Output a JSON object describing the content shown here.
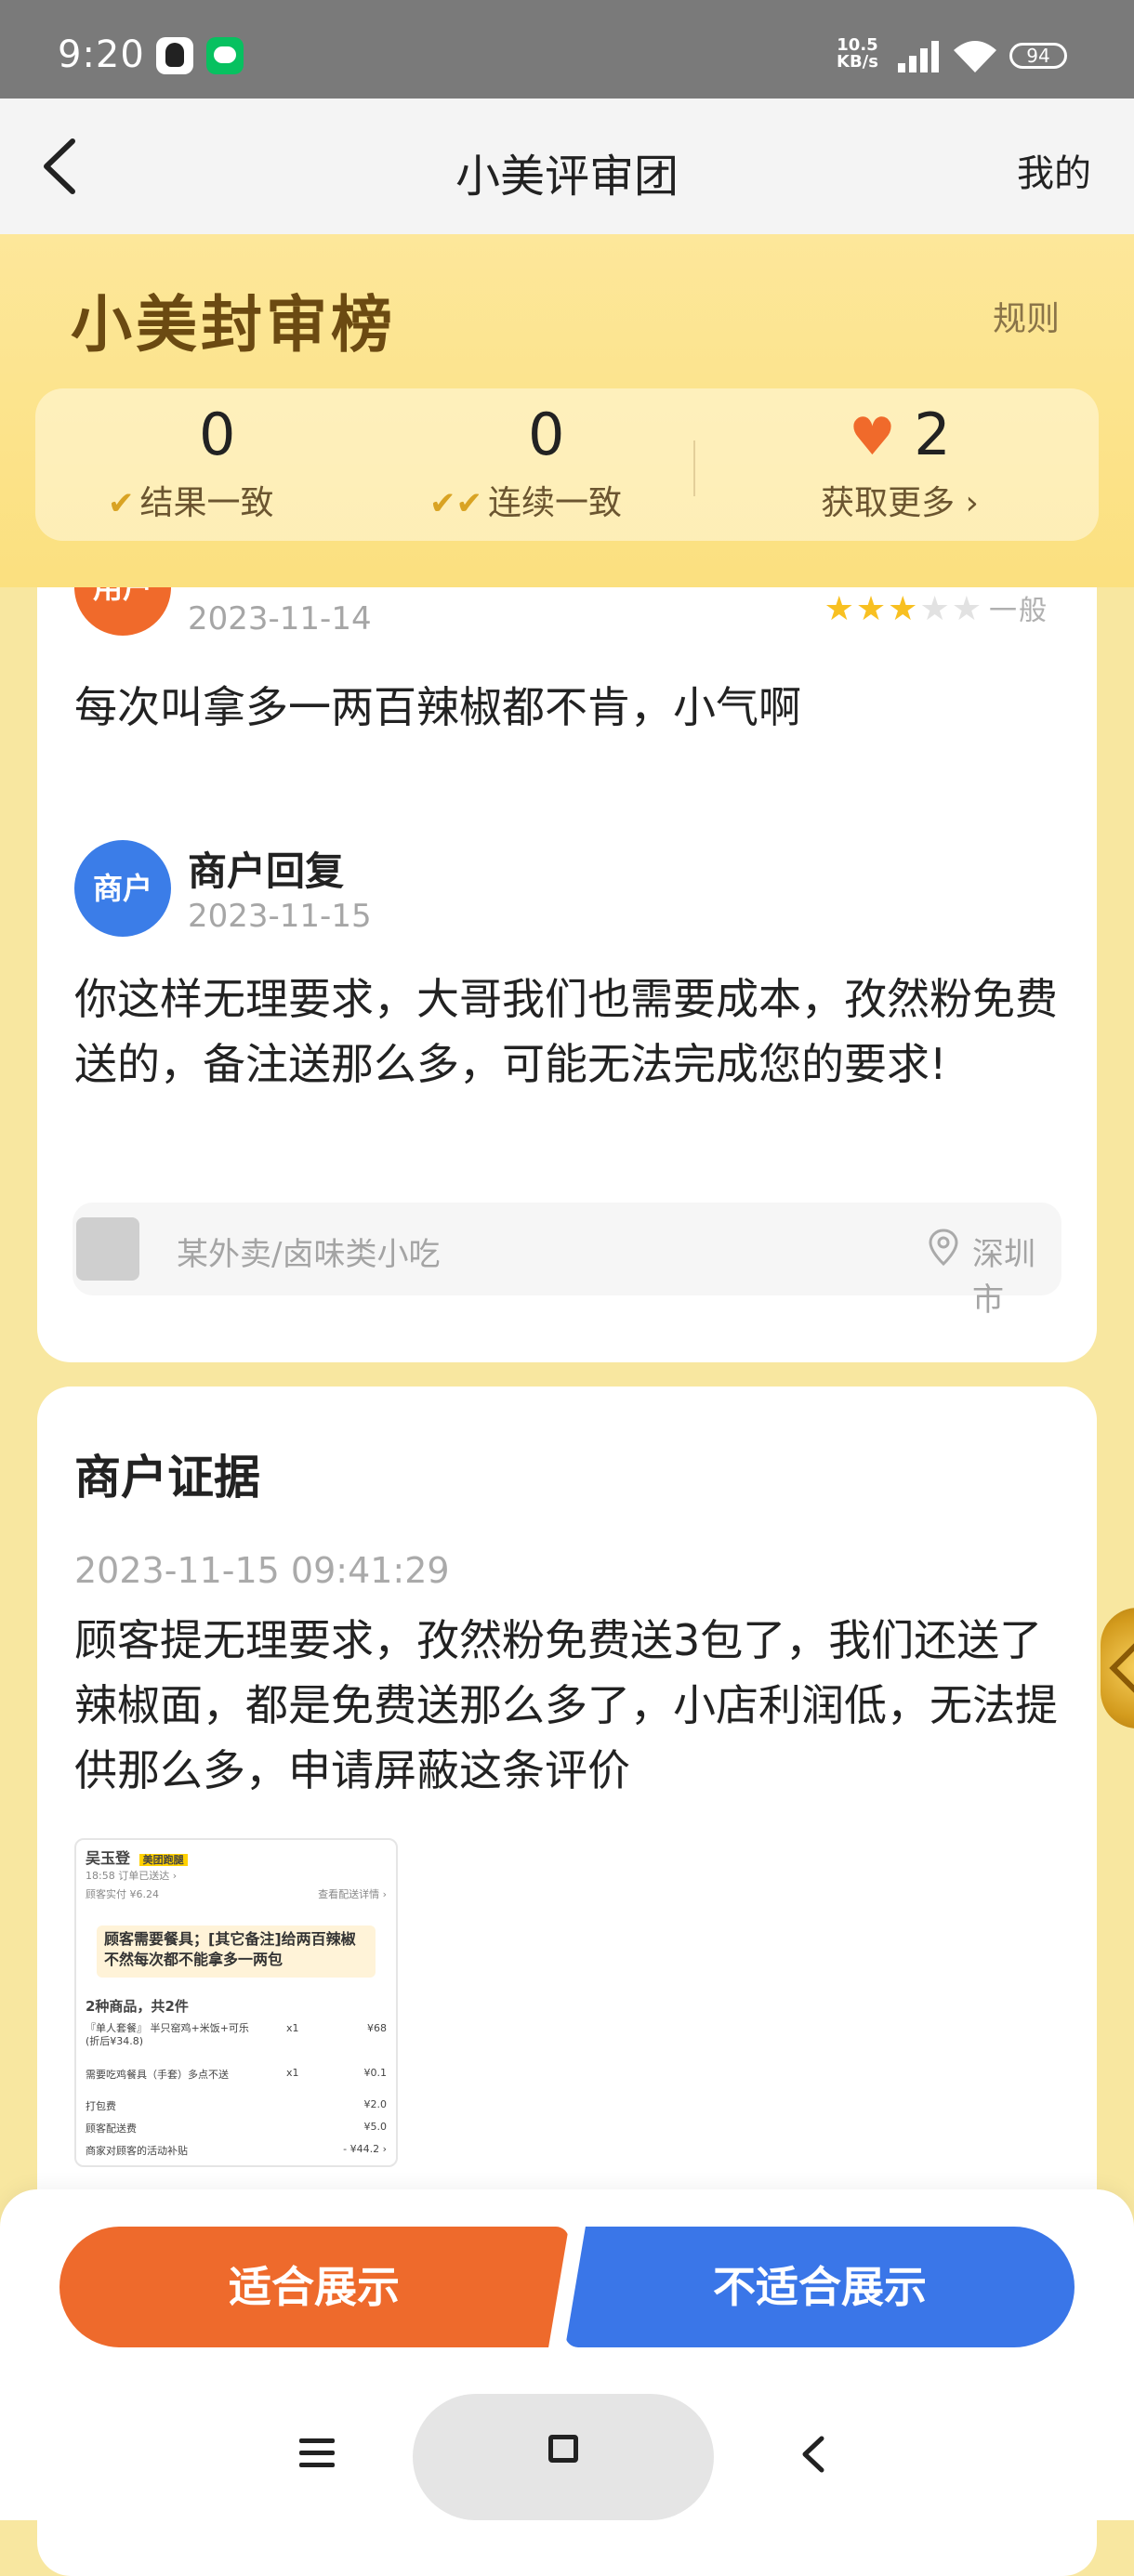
{
  "status_bar": {
    "time": "9:20",
    "net_speed_top": "10.5",
    "net_speed_bottom": "KB/s",
    "battery": "94"
  },
  "nav": {
    "title": "小美评审团",
    "right_label": "我的"
  },
  "header": {
    "brand": "小美封审榜",
    "rules": "规则",
    "stats": [
      {
        "value": "0",
        "label": "结果一致"
      },
      {
        "value": "0",
        "label": "连续一致"
      },
      {
        "value": "2",
        "label": "获取更多 ›"
      }
    ]
  },
  "review": {
    "author_badge": "用户",
    "date": "2023-11-14",
    "rating_label": "一般",
    "rating": 3,
    "rating_max": 5,
    "text": "每次叫拿多一两百辣椒都不肯，小气啊",
    "reply": {
      "badge": "商户",
      "author": "商户回复",
      "date": "2023-11-15",
      "text": "你这样无理要求，大哥我们也需要成本，孜然粉免费送的，备注送那么多，可能无法完成您的要求!"
    },
    "shop": {
      "name": "某外卖/卤味类小吃",
      "city": "深圳市"
    }
  },
  "evidence": {
    "title": "商户证据",
    "time": "2023-11-15 09:41:29",
    "text": "顾客提无理要求，孜然粉免费送3包了，我们还送了辣椒面，都是免费送那么多了，小店利润低，无法提供那么多，申请屏蔽这条评价",
    "screenshot": {
      "name": "吴玉登",
      "tag": "美团跑腿",
      "row1": "18:58 订单已送达 ›",
      "row2": "顾客实付 ¥6.24",
      "row2_right": "查看配送详情 ›",
      "note": "顾客需要餐具；[其它备注]给两百辣椒不然每次都不能拿多一两包",
      "summary": "2种商品，共2件",
      "item1": "『单人套餐』 半只窑鸡+米饭+可乐(折后¥34.8)",
      "item1_qty": "x1",
      "item1_price": "¥68",
      "item2": "需要吃鸡餐具（手套）多点不送",
      "item2_qty": "x1",
      "item2_price": "¥0.1",
      "fee1": "打包费",
      "fee1_val": "¥2.0",
      "fee2": "顾客配送费",
      "fee2_val": "¥5.0",
      "fee3": "商家对顾客的活动补贴",
      "fee3_val": "- ¥44.2 ›"
    }
  },
  "actions": {
    "suitable": "适合展示",
    "unsuitable": "不适合展示"
  },
  "colors": {
    "accent_orange": "#ee6a2c",
    "accent_blue": "#3a76e8",
    "header_yellow": "#fde79a"
  }
}
